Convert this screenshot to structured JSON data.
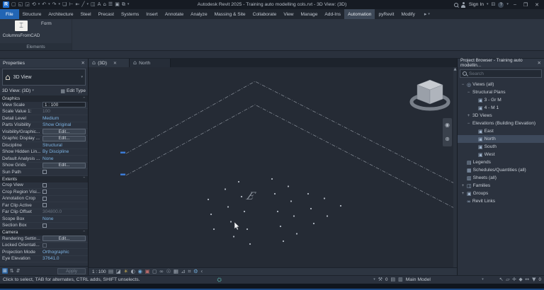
{
  "title_bar": {
    "app_title": "Autodesk Revit 2025 - Training auto modelling cols.rvt - 3D View: (3D)",
    "sign_in_label": "Sign In",
    "qat_icons": [
      "new",
      "open",
      "save",
      "sync",
      "undo",
      "redo",
      "print",
      "measure",
      "aligned-dimension",
      "model-line",
      "section",
      "text",
      "default-3d-view",
      "thin-lines",
      "close-hidden-windows",
      "switch-windows"
    ],
    "window_controls": {
      "minimize": "–",
      "restore": "❐",
      "close": "✕"
    }
  },
  "ribbon": {
    "tabs": [
      "File",
      "Structure",
      "Architecture",
      "Steel",
      "Precast",
      "Systems",
      "Insert",
      "Annotate",
      "Analyze",
      "Massing & Site",
      "Collaborate",
      "View",
      "Manage",
      "Add-Ins",
      "Automation",
      "pyRevit",
      "Modify"
    ],
    "active_tab": "Automation",
    "form_label": "Form",
    "tool_button_label": "ColumnsFromCAD",
    "panel_label": "Elements"
  },
  "properties": {
    "header": "Properties",
    "type_label": "3D View",
    "instance_label": "3D View: (3D)",
    "edit_type_label": "Edit Type",
    "apply_label": "Apply",
    "sections": [
      {
        "name": "Graphics",
        "rows": [
          {
            "label": "View Scale",
            "value": "1 : 100",
            "kind": "input"
          },
          {
            "label": "Scale Value    1:",
            "value": "100",
            "kind": "gray"
          },
          {
            "label": "Detail Level",
            "value": "Medium",
            "kind": "value"
          },
          {
            "label": "Parts Visibility",
            "value": "Show Original",
            "kind": "value"
          },
          {
            "label": "Visibility/Graphic...",
            "value": "Edit...",
            "kind": "button"
          },
          {
            "label": "Graphic Display ...",
            "value": "Edit...",
            "kind": "button"
          },
          {
            "label": "Discipline",
            "value": "Structural",
            "kind": "value"
          },
          {
            "label": "Show Hidden Lin...",
            "value": "By Discipline",
            "kind": "value"
          },
          {
            "label": "Default Analysis ...",
            "value": "None",
            "kind": "value"
          },
          {
            "label": "Show Grids",
            "value": "Edit...",
            "kind": "button"
          },
          {
            "label": "Sun Path",
            "value": "",
            "kind": "check"
          }
        ]
      },
      {
        "name": "Extents",
        "rows": [
          {
            "label": "Crop View",
            "value": "",
            "kind": "check"
          },
          {
            "label": "Crop Region Visi...",
            "value": "",
            "kind": "check"
          },
          {
            "label": "Annotation Crop",
            "value": "",
            "kind": "check"
          },
          {
            "label": "Far Clip Active",
            "value": "",
            "kind": "check"
          },
          {
            "label": "Far Clip Offset",
            "value": "304800.0",
            "kind": "gray"
          },
          {
            "label": "Scope Box",
            "value": "None",
            "kind": "value"
          },
          {
            "label": "Section Box",
            "value": "",
            "kind": "check"
          }
        ]
      },
      {
        "name": "Camera",
        "rows": [
          {
            "label": "Rendering Settin...",
            "value": "Edit...",
            "kind": "button"
          },
          {
            "label": "Locked Orientati...",
            "value": "",
            "kind": "check-gray"
          },
          {
            "label": "Projection Mode",
            "value": "Orthographic",
            "kind": "value"
          },
          {
            "label": "Eye Elevation",
            "value": "37641.0",
            "kind": "value"
          }
        ]
      }
    ]
  },
  "viewport": {
    "tabs": [
      {
        "label": "(3D)",
        "active": true,
        "closable": true
      },
      {
        "label": "North",
        "active": false,
        "closable": false
      }
    ],
    "view_scale": "1 : 100",
    "grid_bubble_label": "E",
    "view_bar_icons": [
      "detail-level",
      "visual-style",
      "sun-path",
      "shadows",
      "render",
      "crop-view",
      "crop-region",
      "temporary-hide-isolate",
      "reveal-hidden",
      "temporary-view-properties",
      "analytical-model",
      "reveal-constraints",
      "worksharing-display",
      "collapse"
    ]
  },
  "project_browser": {
    "header": "Project Browser - Training auto modellin...",
    "search_placeholder": "Search",
    "tree": [
      {
        "indent": 0,
        "expand": "−",
        "icon": "views",
        "label": "Views (all)"
      },
      {
        "indent": 1,
        "expand": "−",
        "icon": "",
        "label": "Structural Plans"
      },
      {
        "indent": 2,
        "expand": "",
        "icon": "plan",
        "label": "3 - Gr M"
      },
      {
        "indent": 2,
        "expand": "",
        "icon": "plan",
        "label": "4 - M 1"
      },
      {
        "indent": 1,
        "expand": "+",
        "icon": "",
        "label": "3D Views"
      },
      {
        "indent": 1,
        "expand": "−",
        "icon": "",
        "label": "Elevations (Building Elevation)"
      },
      {
        "indent": 2,
        "expand": "",
        "icon": "plan",
        "label": "East"
      },
      {
        "indent": 2,
        "expand": "",
        "icon": "plan",
        "label": "North",
        "selected": true
      },
      {
        "indent": 2,
        "expand": "",
        "icon": "plan",
        "label": "South"
      },
      {
        "indent": 2,
        "expand": "",
        "icon": "plan",
        "label": "West"
      },
      {
        "indent": 0,
        "expand": "",
        "icon": "legend",
        "label": "Legends"
      },
      {
        "indent": 0,
        "expand": "",
        "icon": "schedule",
        "label": "Schedules/Quantities (all)"
      },
      {
        "indent": 0,
        "expand": "",
        "icon": "sheet",
        "label": "Sheets (all)"
      },
      {
        "indent": 0,
        "expand": "+",
        "icon": "family",
        "label": "Families"
      },
      {
        "indent": 0,
        "expand": "+",
        "icon": "group",
        "label": "Groups"
      },
      {
        "indent": 0,
        "expand": "",
        "icon": "link",
        "label": "Revit Links"
      }
    ]
  },
  "status_bar": {
    "hint": "Click to select, TAB for alternates, CTRL adds, SHIFT unselects.",
    "worksets_count": "0",
    "active_workset_label": "Main Model",
    "selection_icons": [
      "select-links",
      "select-underlay",
      "select-pinned",
      "select-by-face",
      "drag-on-selection"
    ],
    "filter_count": "0"
  }
}
